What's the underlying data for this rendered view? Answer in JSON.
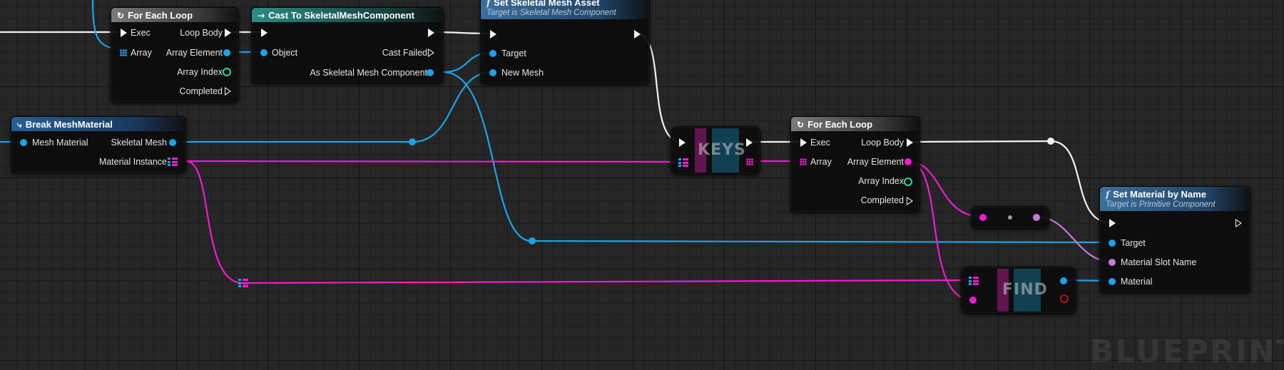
{
  "nodes": {
    "for_each_loop_1": {
      "title": "For Each Loop",
      "exec_in": "Exec",
      "array_in": "Array",
      "loop_body": "Loop Body",
      "array_element": "Array Element",
      "array_index": "Array Index",
      "completed": "Completed"
    },
    "cast_skeletal": {
      "title": "Cast To SkeletalMeshComponent",
      "object_in": "Object",
      "cast_failed": "Cast Failed",
      "as_component": "As Skeletal Mesh Component"
    },
    "set_skeletal_mesh_asset": {
      "title": "Set Skeletal Mesh Asset",
      "subtitle": "Target is Skeletal Mesh Component",
      "target": "Target",
      "new_mesh": "New Mesh"
    },
    "break_mesh_material": {
      "title": "Break MeshMaterial",
      "mesh_material": "Mesh Material",
      "skeletal_mesh": "Skeletal Mesh",
      "material_instance": "Material Instance"
    },
    "keys": {
      "title": "KEYS"
    },
    "for_each_loop_2": {
      "title": "For Each Loop",
      "exec_in": "Exec",
      "array_in": "Array",
      "loop_body": "Loop Body",
      "array_element": "Array Element",
      "array_index": "Array Index",
      "completed": "Completed"
    },
    "find": {
      "title": "FIND"
    },
    "set_material_by_name": {
      "title": "Set Material by Name",
      "subtitle": "Target is Primitive Component",
      "target": "Target",
      "material_slot_name": "Material Slot Name",
      "material": "Material"
    }
  },
  "watermark": "BLUEPRINT",
  "colors": {
    "exec": "#f2f2f2",
    "object": "#1aa3e8",
    "array_map": "#ef1bd0",
    "name": "#c57ad6",
    "int": "#2bd99a",
    "bool": "#b3111a"
  },
  "icons": {
    "loop": "loop-icon",
    "cast": "cast-icon",
    "function": "function-icon",
    "break": "break-struct-icon"
  }
}
